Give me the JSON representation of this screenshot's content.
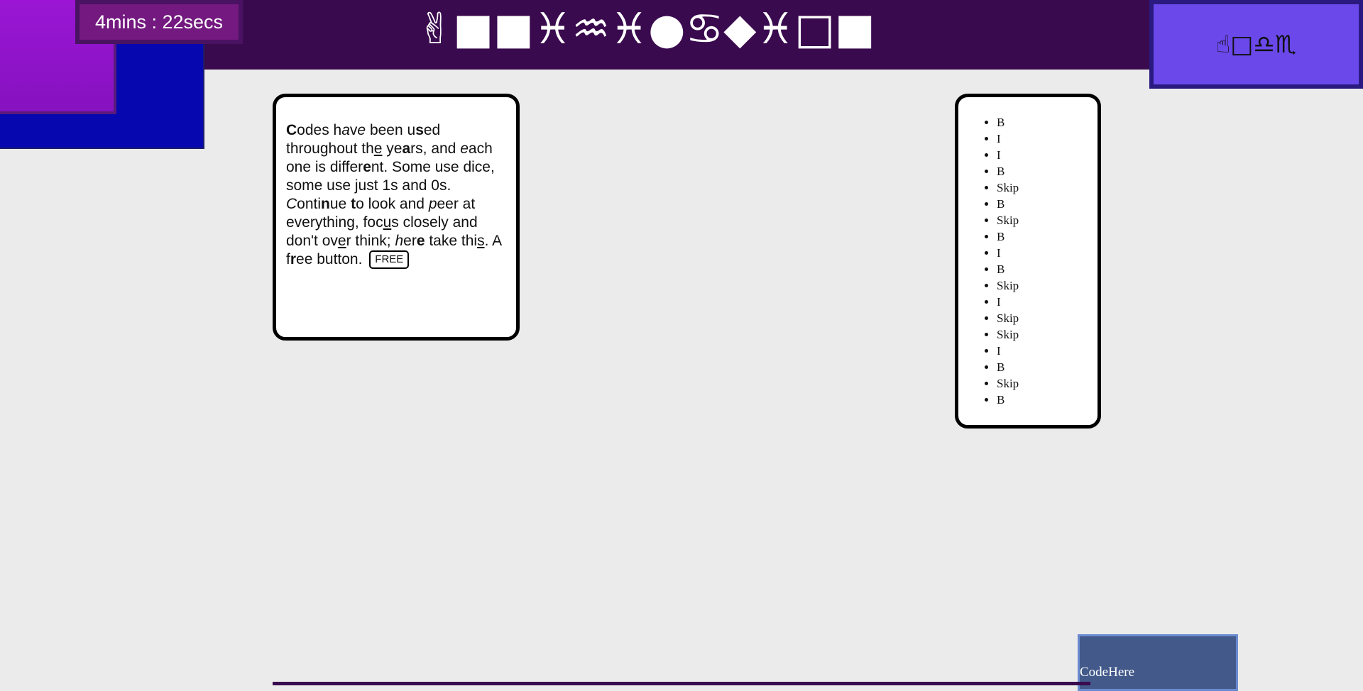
{
  "timer": {
    "text": "4mins : 22secs"
  },
  "header_symbols": [
    "✌",
    "■",
    "■",
    "♓",
    "♒",
    "♓",
    "●",
    "♋",
    "◆",
    "♓",
    "□",
    "■"
  ],
  "corner_box": {
    "symbols": "☝□♎♏"
  },
  "text_card": {
    "segments": [
      {
        "t": "C",
        "s": "b"
      },
      {
        "t": "odes h",
        "s": ""
      },
      {
        "t": "a",
        "s": "i"
      },
      {
        "t": "v",
        "s": ""
      },
      {
        "t": "e",
        "s": "i"
      },
      {
        "t": " been u",
        "s": ""
      },
      {
        "t": "s",
        "s": "b"
      },
      {
        "t": "ed throughout th",
        "s": ""
      },
      {
        "t": "e",
        "s": "u"
      },
      {
        "t": " ye",
        "s": ""
      },
      {
        "t": "a",
        "s": "b"
      },
      {
        "t": "rs, and ",
        "s": ""
      },
      {
        "t": "e",
        "s": "i"
      },
      {
        "t": "ach one is differ",
        "s": ""
      },
      {
        "t": "e",
        "s": "b"
      },
      {
        "t": "nt. Some use dice, some use just 1s and 0s. ",
        "s": ""
      },
      {
        "t": "C",
        "s": "i"
      },
      {
        "t": "onti",
        "s": ""
      },
      {
        "t": "n",
        "s": "b"
      },
      {
        "t": "ue ",
        "s": ""
      },
      {
        "t": "t",
        "s": "b"
      },
      {
        "t": "o look and ",
        "s": ""
      },
      {
        "t": "p",
        "s": "i"
      },
      {
        "t": "eer at everything, foc",
        "s": ""
      },
      {
        "t": "u",
        "s": "u"
      },
      {
        "t": "s closely and don't ov",
        "s": ""
      },
      {
        "t": "e",
        "s": "u"
      },
      {
        "t": "r think; ",
        "s": ""
      },
      {
        "t": "h",
        "s": "i"
      },
      {
        "t": "er",
        "s": ""
      },
      {
        "t": "e",
        "s": "b"
      },
      {
        "t": " take thi",
        "s": ""
      },
      {
        "t": "s",
        "s": "u"
      },
      {
        "t": ". A f",
        "s": ""
      },
      {
        "t": "r",
        "s": "b"
      },
      {
        "t": "ee button.",
        "s": ""
      }
    ],
    "button_label": "FREE"
  },
  "list_card": {
    "items": [
      "B",
      "I",
      "I",
      "B",
      "Skip",
      "B",
      "Skip",
      "B",
      "I",
      "B",
      "Skip",
      "I",
      "Skip",
      "Skip",
      "I",
      "B",
      "Skip",
      "B"
    ]
  },
  "code_box": {
    "label": "CodeHere"
  },
  "colors": {
    "header": "#3a0a4e",
    "blue_square": "#0707b0",
    "purple_square": "#9a16d4",
    "corner_box": "#6a48ea",
    "code_box": "#42598a",
    "background": "#ebebeb"
  }
}
